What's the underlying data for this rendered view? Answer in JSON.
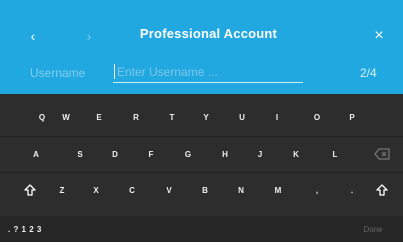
{
  "header": {
    "back_icon": "‹",
    "forward_icon": "›",
    "title": "Professional Account",
    "close_icon": "×"
  },
  "field": {
    "label": "Username",
    "placeholder": "Enter Username ...",
    "step": "2/4"
  },
  "keyboard": {
    "row1": [
      "Q",
      "W",
      "E",
      "R",
      "T",
      "Y",
      "U",
      "I",
      "O",
      "P"
    ],
    "row2": [
      "A",
      "S",
      "D",
      "F",
      "G",
      "H",
      "J",
      "K",
      "L"
    ],
    "row3": [
      "Z",
      "X",
      "C",
      "V",
      "B",
      "N",
      "M",
      ",",
      "."
    ],
    "mode_label": ". ? 1 2 3",
    "done_label": "Done"
  },
  "colors": {
    "accent": "#21a8e0",
    "keyboard_bg": "#2d2d2d"
  }
}
